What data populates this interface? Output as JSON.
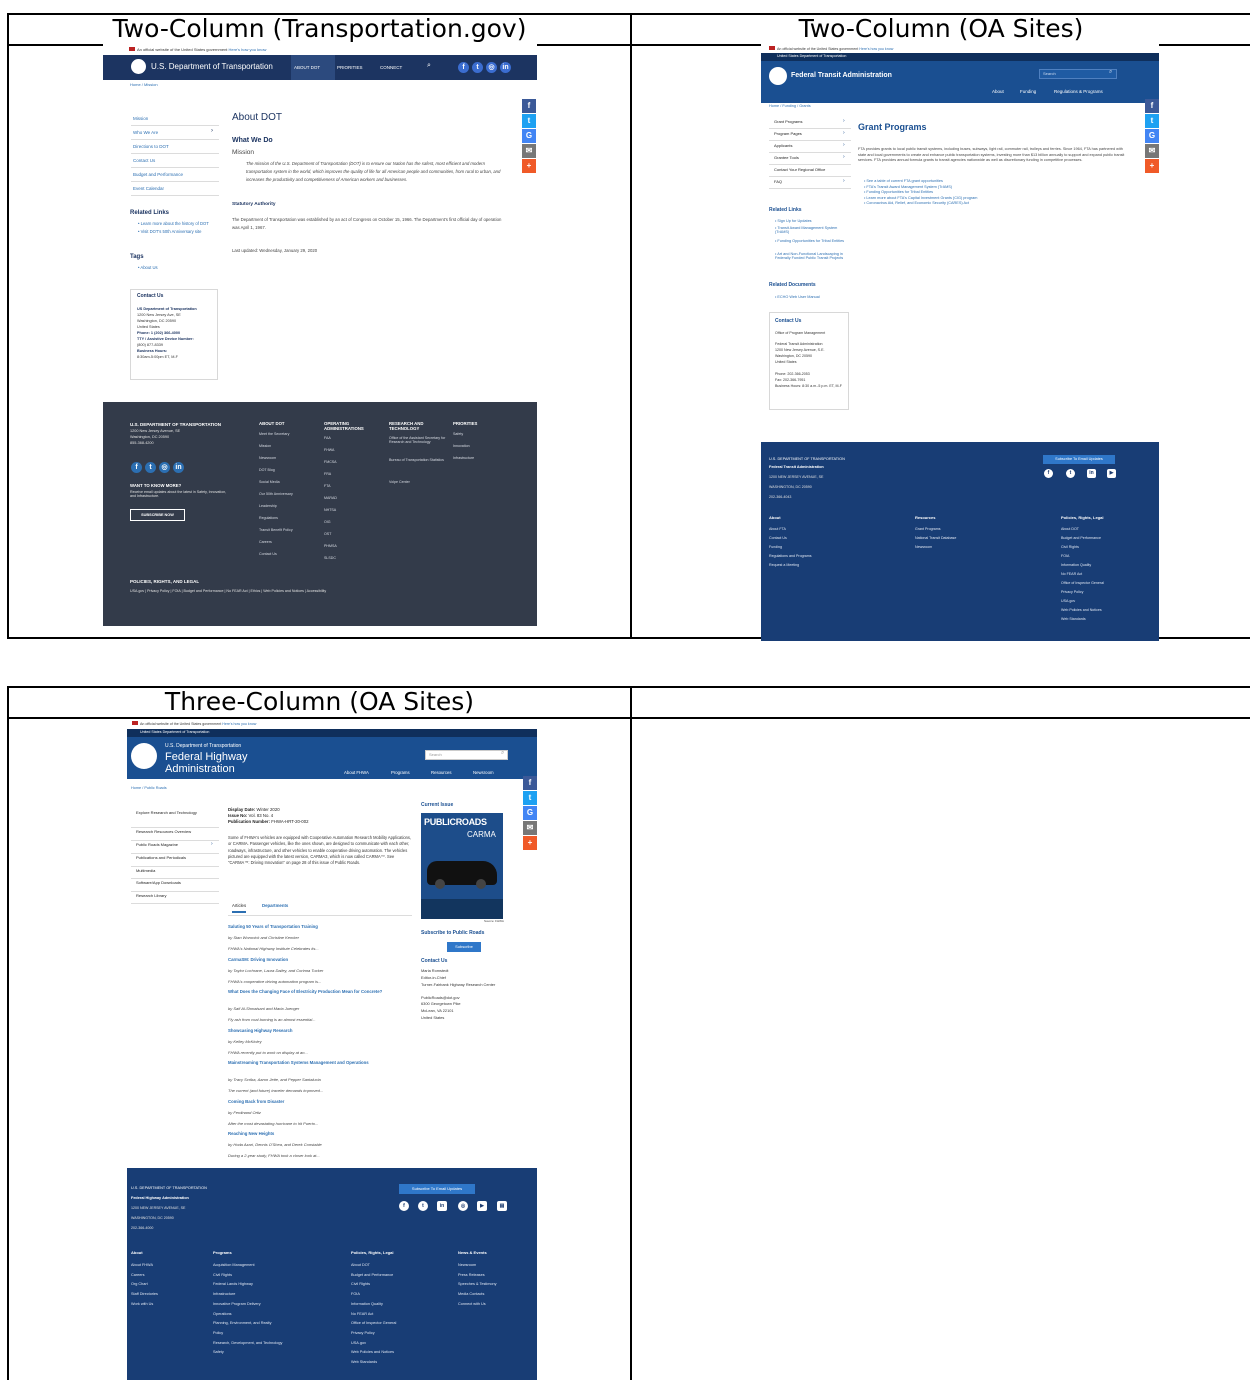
{
  "layout_labels": {
    "tl": "Two-Column (Transportation.gov)",
    "tr": "Two-Column (OA Sites)",
    "bl": "Three-Column (OA Sites)"
  },
  "colors": {
    "dot_nav": "#1c3461",
    "dot_footer": "#333b4a",
    "oa_blue": "#1a4f91",
    "oa_footer": "#183d75",
    "facebook": "#3b5998",
    "twitter": "#1da1f2",
    "google": "#4285f4",
    "email": "#777777",
    "share": "#f05a28"
  },
  "dot": {
    "gov_banner": "An official website of the United States government",
    "gov_banner_link": "Here's how you know",
    "brand": "U.S. Department of Transportation",
    "nav": [
      "ABOUT DOT",
      "PRIORITIES",
      "CONNECT"
    ],
    "breadcrumb": [
      "Home",
      "Mission"
    ],
    "sidenav": [
      "Mission",
      "Who We Are",
      "Directions to DOT",
      "Contact Us",
      "Budget and Performance",
      "Event Calendar"
    ],
    "related_title": "Related Links",
    "related": [
      "Learn more about the history of DOT",
      "Visit DOT's 50th Anniversary site"
    ],
    "tags_title": "Tags",
    "tags": [
      "About Us"
    ],
    "contact": {
      "title": "Contact Us",
      "org": "US Department of Transportation",
      "addr1": "1200 New Jersey Ave, SE",
      "addr2": "Washington, DC 20590",
      "country": "United States",
      "phone": "Phone: 1 (202) 366-4000",
      "tty": "TTY / Assistive Device Number:",
      "tty_num": "(800) 877-8339",
      "hours_label": "Business Hours:",
      "hours": "8:30am-5:00pm ET, M-F"
    },
    "page_title": "About DOT",
    "what_we_do": "What We Do",
    "mission": "Mission",
    "mission_text": "The mission of the U.S. Department of Transportation (DOT) is to ensure our Nation has the safest, most efficient and modern transportation system in the world, which improves the quality of life for all American people and communities, from rural to urban, and increases the productivity and competitiveness of American workers and businesses.",
    "statutory": "Statutory Authority",
    "statutory_text": "The Department of Transportation was established by an act of Congress on October 15, 1966. The Department's first official day of operation was April 1, 1967.",
    "updated": "Last updated: Wednesday, January 29, 2020",
    "footer": {
      "org": "U.S. DEPARTMENT OF TRANSPORTATION",
      "addr1": "1200 New Jersey Avenue, SE",
      "addr2": "Washington, DC 20590",
      "phone": "855-368-4200",
      "want": "WANT TO KNOW MORE?",
      "want_text": "Receive email updates about the latest in Safety, Innovation, and Infrastructure.",
      "subscribe": "SUBSCRIBE NOW",
      "columns": [
        {
          "title": "ABOUT DOT",
          "items": [
            "Meet the Secretary",
            "Mission",
            "Newsroom",
            "DOT Blog",
            "Social Media",
            "Our 50th Anniversary",
            "Leadership",
            "Regulations",
            "Transit Benefit Policy",
            "Careers",
            "Contact Us"
          ]
        },
        {
          "title": "OPERATING ADMINISTRATIONS",
          "items": [
            "FAA",
            "FHWA",
            "FMCSA",
            "FRA",
            "FTA",
            "MARAD",
            "NHTSA",
            "OIG",
            "OST",
            "PHMSA",
            "SLSDC"
          ]
        },
        {
          "title": "RESEARCH AND TECHNOLOGY",
          "items": [
            "Office of the Assistant Secretary for Research and Technology",
            "Bureau of Transportation Statistics",
            "Volpe Center"
          ]
        },
        {
          "title": "PRIORITIES",
          "items": [
            "Safety",
            "Innovation",
            "Infrastructure"
          ]
        }
      ],
      "policies_title": "POLICIES, RIGHTS, AND LEGAL",
      "policies": "USA.gov | Privacy Policy | FOIA | Budget and Performance | No FEAR Act | Ethics | Web Policies and Notices | Accessibility"
    }
  },
  "fta": {
    "gov_banner": "An official website of the United States government",
    "gov_banner_link": "Here's how you know",
    "dept": "United States Department of Transportation",
    "brand": "Federal Transit Administration",
    "search": "Search",
    "nav": [
      "About",
      "Funding",
      "Regulations & Programs"
    ],
    "breadcrumb": [
      "Home",
      "Funding",
      "Grants"
    ],
    "sidenav": [
      "Grant Programs",
      "Program Pages",
      "Applicants",
      "Grantee Tools",
      "Contact Your Regional Office",
      "FAQ"
    ],
    "related_title": "Related Links",
    "related": [
      "Sign Up for Updates",
      "Transit Award Management System (TrAMS)",
      "Funding Opportunities for Tribal Entities",
      "Art and Non-Functional Landscaping in Federally Funded Public Transit Projects"
    ],
    "docs_title": "Related Documents",
    "docs": [
      "ECHO Web User Manual"
    ],
    "contact": {
      "title": "Contact Us",
      "lines": [
        "Office of Program Management",
        "Federal Transit Administration",
        "1200 New Jersey Avenue, S.E.",
        "Washington, DC 20590",
        "United States"
      ],
      "phone": "Phone: 202-366-2053",
      "fax": "Fax: 202-366-7951",
      "hours": "Business Hours: 8:30 a.m.-5 p.m. ET, M-F"
    },
    "page_title": "Grant Programs",
    "body": "FTA provides grants to local public transit systems, including buses, subways, light rail, commuter rail, trolleys and ferries. Since 1964, FTA has partnered with state and local governments to create and enhance public transportation systems, investing more than $13 billion annually to support and expand public transit services. FTA provides annual formula grants to transit agencies nationwide as well as discretionary funding in competitive processes.",
    "bullets": [
      "See a table of current FTA grant opportunities",
      "FTA's Transit Award Management System (TrAMS)",
      "Funding Opportunities for Tribal Entities",
      "Learn more about FTA's Capital Investment Grants (CIG) program",
      "Coronavirus Aid, Relief, and Economic Security (CARES) Act"
    ],
    "footer": {
      "dept": "U.S. DEPARTMENT OF TRANSPORTATION",
      "org": "Federal Transit Administration",
      "addr1": "1200 NEW JERSEY AVENUE, SE",
      "addr2": "WASHINGTON, DC 20590",
      "phone": "202-366-4043",
      "subscribe": "Subscribe To Email Updates",
      "columns": [
        {
          "title": "About",
          "items": [
            "About FTA",
            "Contact Us",
            "Funding",
            "Regulations and Programs",
            "Request a Meeting"
          ]
        },
        {
          "title": "Resources",
          "items": [
            "Grant Programs",
            "National Transit Database",
            "Newsroom"
          ]
        },
        {
          "title": "Policies, Rights, Legal",
          "items": [
            "About DOT",
            "Budget and Performance",
            "Civil Rights",
            "FOIA",
            "Information Quality",
            "No FEAR Act",
            "Office of Inspector General",
            "Privacy Policy",
            "USA.gov",
            "Web Policies and Notices",
            "Web Standards"
          ]
        }
      ]
    }
  },
  "fhwa": {
    "gov_banner": "An official website of the United States government",
    "gov_banner_link": "Here's how you know",
    "dept": "United States Department of Transportation",
    "brand_small": "U.S. Department of Transportation",
    "brand_l1": "Federal Highway",
    "brand_l2": "Administration",
    "search": "Search",
    "nav": [
      "About FHWA",
      "Programs",
      "Resources",
      "Newsroom"
    ],
    "breadcrumb": [
      "Home",
      "Public Roads"
    ],
    "sidenav": [
      "Explore Research and Technology",
      "Research Resources Overview",
      "Public Roads Magazine",
      "Publications and Periodicals",
      "Multimedia",
      "Software/App Downloads",
      "Research Library"
    ],
    "display_date_label": "Display Date:",
    "display_date": "Winter 2020",
    "issue_label": "Issue No:",
    "issue": "Vol. 83 No. 4",
    "pubnum_label": "Publication Number:",
    "pubnum": "FHWA-HRT-20-002",
    "intro": "Some of FHWA's vehicles are equipped with Cooperative Automation Research Mobility Applications, or CARMA. Passenger vehicles, like the ones shown, are designed to communicate with each other, roadways, infrastructure, and other vehicles to enable cooperative driving automation. The vehicles pictured are equipped with the latest version, CARMA3, which is now called CARMA™. See \"CARMA™: Driving Innovation\" on page 28 of this issue of Public Roads.",
    "tabs": [
      "Articles",
      "Departments"
    ],
    "articles": [
      {
        "title": "Saluting 50 Years of Transportation Training",
        "by": "by Stan Woronick and Christine Kemker",
        "teaser": "FHWA's National Highway Institute Celebrates its..."
      },
      {
        "title": "CarmaSM: Driving Innovation",
        "by": "by Taylor Lochrane, Laura Dailey, and Corinna Tucker",
        "teaser": "FHWA's cooperative driving automation program is..."
      },
      {
        "title": "What Does the Changing Face of Electricity Production Mean for Concrete?",
        "by": "by Saif Al-Shmaisani and Maria Juenger",
        "teaser": "Fly ash from coal burning is an almost essential..."
      },
      {
        "title": "Showcasing Highway Research",
        "by": "by Kelley McKinley",
        "teaser": "FHWA recently put to work on display at an..."
      },
      {
        "title": "Mainstreaming Transportation Systems Management and Operations",
        "by": "by Tracy Scriba, Aaron Jette, and Pepper Santalucia",
        "teaser": "The current (and future) traveler demands improved..."
      },
      {
        "title": "Coming Back from Disaster",
        "by": "by Ferdinand Ortiz",
        "teaser": "After the most devastating hurricane to hit Puerto..."
      },
      {
        "title": "Reaching New Heights",
        "by": "by Hoda Azari, Dennis O'Shea, and Derek Constable",
        "teaser": "During a 2-year study, FHWA took a closer look at..."
      }
    ],
    "current_issue": "Current Issue",
    "cover_brand": "PUBLICROADS",
    "cover_title": "CARMA",
    "cover_source": "Source: FHWA",
    "subscribe_title": "Subscribe to Public Roads",
    "subscribe_btn": "Subscribe",
    "contact_title": "Contact Us",
    "contact_lines": [
      "Maria Romstedt",
      "Editor-in-Chief",
      "Turner-Fairbank Highway Research Center",
      "PublicRoads@dot.gov",
      "6300 Georgetown Pike",
      "McLean, VA 22101",
      "United States"
    ],
    "footer": {
      "dept": "U.S. DEPARTMENT OF TRANSPORTATION",
      "org": "Federal Highway Administration",
      "addr1": "1200 NEW JERSEY AVENUE, SE",
      "addr2": "WASHINGTON, DC 20590",
      "phone": "202-366-4000",
      "subscribe": "Subscribe To Email Updates",
      "columns": [
        {
          "title": "About",
          "items": [
            "About FHWA",
            "Careers",
            "Org Chart",
            "Staff Directories",
            "Work with Us"
          ]
        },
        {
          "title": "Programs",
          "items": [
            "Acquisition Management",
            "Civil Rights",
            "Federal Lands Highway",
            "Infrastructure",
            "Innovative Program Delivery",
            "Operations",
            "Planning, Environment, and Realty",
            "Policy",
            "Research, Development, and Technology",
            "Safety"
          ]
        },
        {
          "title": "Policies, Rights, Legal",
          "items": [
            "About DOT",
            "Budget and Performance",
            "Civil Rights",
            "FOIA",
            "Information Quality",
            "No FEAR Act",
            "Office of Inspector General",
            "Privacy Policy",
            "USA.gov",
            "Web Policies and Notices",
            "Web Standards"
          ]
        },
        {
          "title": "News & Events",
          "items": [
            "Newsroom",
            "Press Releases",
            "Speeches & Testimony",
            "Media Contacts",
            "Connect with Us"
          ]
        }
      ]
    }
  }
}
